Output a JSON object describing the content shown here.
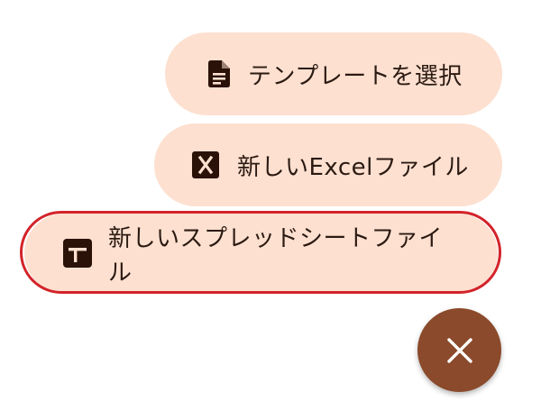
{
  "menu": {
    "items": [
      {
        "label": "テンプレートを選択",
        "icon": "document-icon"
      },
      {
        "label": "新しいExcelファイル",
        "icon": "excel-icon"
      },
      {
        "label": "新しいスプレッドシートファイル",
        "icon": "spreadsheet-plus-icon"
      }
    ]
  },
  "close_fab": {
    "icon": "close-icon"
  },
  "colors": {
    "item_background": "#fde0d0",
    "text": "#2b1a12",
    "icon_dark": "#2b1208",
    "fab_background": "#8b4a2b",
    "highlight_border": "#d3232a"
  }
}
